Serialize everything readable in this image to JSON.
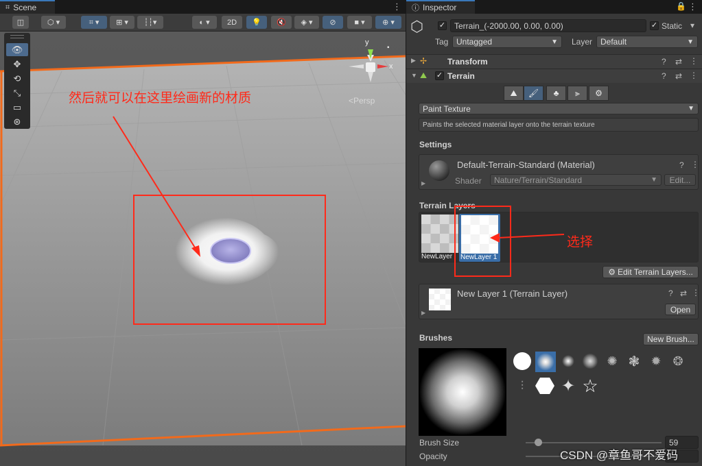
{
  "scene": {
    "tab_label": "Scene",
    "toolbar": {
      "mode_2d": "2D"
    },
    "gizmo": {
      "axis_y": "y",
      "axis_x": "x",
      "persp_label": "<Persp"
    },
    "annotation_text": "然后就可以在这里绘画新的材质"
  },
  "inspector": {
    "tab_label": "Inspector",
    "object_name": "Terrain_(-2000.00, 0.00, 0.00)",
    "static_label": "Static",
    "tag_label": "Tag",
    "tag_value": "Untagged",
    "layer_label": "Layer",
    "layer_value": "Default",
    "components": {
      "transform": "Transform",
      "terrain": "Terrain"
    },
    "paint_mode": "Paint Texture",
    "paint_help": "Paints the selected material layer onto the terrain texture",
    "settings_label": "Settings",
    "material_name": "Default-Terrain-Standard (Material)",
    "shader_label": "Shader",
    "shader_value": "Nature/Terrain/Standard",
    "edit_button": "Edit...",
    "terrain_layers_label": "Terrain Layers",
    "layers": [
      {
        "label": "NewLayer"
      },
      {
        "label": "NewLayer 1"
      }
    ],
    "edit_layers_button": "Edit Terrain Layers...",
    "layer_asset_name": "New Layer 1 (Terrain Layer)",
    "open_button": "Open",
    "brushes_label": "Brushes",
    "new_brush_button": "New Brush...",
    "brush_size_label": "Brush Size",
    "brush_size_value": "59",
    "brush_size_fraction": 0.09,
    "opacity_label": "Opacity",
    "annotation_select": "选择",
    "watermark": "CSDN @章鱼哥不爱码"
  },
  "colors": {
    "accent_blue": "#46607c",
    "annotation_red": "#ff2a1a",
    "selection_orange": "#f26a1b"
  }
}
